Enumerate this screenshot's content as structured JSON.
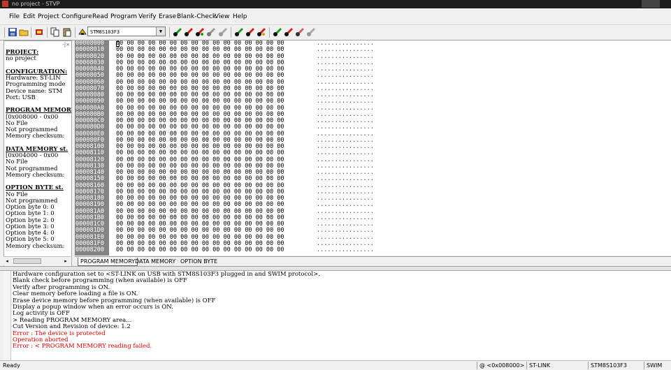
{
  "window": {
    "title": "no project - STVP"
  },
  "menu": [
    "File",
    "Edit",
    "Project",
    "Configure",
    "Read",
    "Program",
    "Verify",
    "Erase",
    "Blank-Check",
    "View",
    "Help"
  ],
  "toolbar": {
    "device_selected": "STM8S103F3",
    "icons": [
      "save-icon",
      "open-icon",
      "project-icon",
      "copy-icon",
      "paste-icon",
      "chip-icon",
      "read-current-icon",
      "program-current-icon",
      "verify-current-icon",
      "erase-icon",
      "blank-check-icon",
      "read-all-icon",
      "program-all-icon",
      "verify-all-icon",
      "read-option-icon",
      "program-option-icon",
      "verify-option-icon",
      "blank-option-icon"
    ]
  },
  "left_panel": {
    "lines": [
      {
        "text": "PROJECT:",
        "head": true
      },
      {
        "text": "no project",
        "head": false
      },
      {
        "text": "",
        "head": false
      },
      {
        "text": "CONFIGURATION:",
        "head": true
      },
      {
        "text": "Hardware: ST-LIN",
        "head": false
      },
      {
        "text": "Programming mode",
        "head": false
      },
      {
        "text": "Device name: STM",
        "head": false
      },
      {
        "text": "Port: USB",
        "head": false
      },
      {
        "text": "",
        "head": false
      },
      {
        "text": "PROGRAM MEMORY",
        "head": true
      },
      {
        "text": "[0x008000 - 0x00",
        "head": false
      },
      {
        "text": "No File",
        "head": false
      },
      {
        "text": "Not programmed",
        "head": false
      },
      {
        "text": "Memory checksum:",
        "head": false
      },
      {
        "text": "",
        "head": false
      },
      {
        "text": "DATA MEMORY st.",
        "head": true
      },
      {
        "text": "[0x004000 - 0x00",
        "head": false
      },
      {
        "text": "No File",
        "head": false
      },
      {
        "text": "Not programmed",
        "head": false
      },
      {
        "text": "Memory checksum:",
        "head": false
      },
      {
        "text": "",
        "head": false
      },
      {
        "text": "OPTION BYTE st.",
        "head": true
      },
      {
        "text": "No File",
        "head": false
      },
      {
        "text": "Not programmed",
        "head": false
      },
      {
        "text": "Option byte 0: 0",
        "head": false
      },
      {
        "text": "Option byte 1: 0",
        "head": false
      },
      {
        "text": "Option byte 2: 0",
        "head": false
      },
      {
        "text": "Option byte 3: 0",
        "head": false
      },
      {
        "text": "Option byte 4: 0",
        "head": false
      },
      {
        "text": "Option byte 5: 0",
        "head": false
      },
      {
        "text": "Memory checksum:",
        "head": false
      }
    ]
  },
  "memory": {
    "addresses": [
      "00008000",
      "00008010",
      "00008020",
      "00008030",
      "00008040",
      "00008050",
      "00008060",
      "00008070",
      "00008080",
      "00008090",
      "000080A0",
      "000080B0",
      "000080C0",
      "000080D0",
      "000080E0",
      "000080F0",
      "00008100",
      "00008110",
      "00008120",
      "00008130",
      "00008140",
      "00008150",
      "00008160",
      "00008170",
      "00008180",
      "00008190",
      "000081A0",
      "000081B0",
      "000081C0",
      "000081D0",
      "000081E0",
      "000081F0",
      "00008200"
    ],
    "bytes_row": "00 00 00 00 00 00 00 00 00 00 00 00 00 00 00 00",
    "ascii_row": "................"
  },
  "tabs": [
    {
      "label": "PROGRAM MEMORY",
      "active": true
    },
    {
      "label": "DATA MEMORY",
      "active": false
    },
    {
      "label": "OPTION BYTE",
      "active": false
    }
  ],
  "log": [
    {
      "text": "Hardware configuration set to <ST-LINK on USB with STM8S103F3 plugged in and SWIM protocol>.",
      "error": false
    },
    {
      "text": "Blank check before programming (when available) is OFF",
      "error": false
    },
    {
      "text": "Verify after programming is ON.",
      "error": false
    },
    {
      "text": "Clear memory before loading a file is ON.",
      "error": false
    },
    {
      "text": "Erase device memory before programming (when available) is OFF",
      "error": false
    },
    {
      "text": "Display a popup window when an error occurs is ON.",
      "error": false
    },
    {
      "text": "Log activity is OFF",
      "error": false
    },
    {
      "text": "> Reading  PROGRAM MEMORY area...",
      "error": false
    },
    {
      "text": "Cut Version and Revision of device: 1.2",
      "error": false
    },
    {
      "text": "Error : The device is protected",
      "error": true
    },
    {
      "text": "Operation aborted",
      "error": true
    },
    {
      "text": "Error : < PROGRAM MEMORY reading failed.",
      "error": true
    }
  ],
  "status": {
    "ready": "Ready",
    "address": "@ <0x008000>",
    "programmer": "ST-LINK",
    "device": "STM8S103F3",
    "protocol": "SWIM"
  }
}
